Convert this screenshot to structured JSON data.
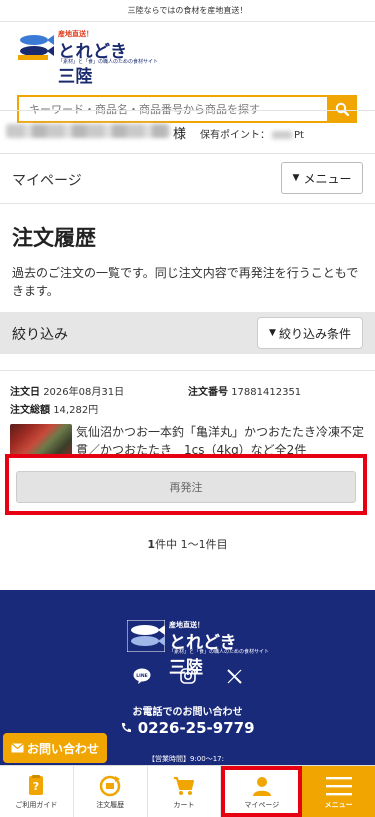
{
  "topbar": {
    "text": "三陸ならではの食材を産地直送！"
  },
  "header": {
    "logo": {
      "tag": "産地直送！",
      "name": "とれどき三陸",
      "sub": "「素材」と「食」の職人のための食材サイト"
    },
    "search": {
      "placeholder": "キーワード・商品名・商品番号から商品を探す"
    }
  },
  "member": {
    "suffix": "様",
    "points_label": "保有ポイント：",
    "points_unit": "Pt"
  },
  "mypage": {
    "title": "マイページ",
    "menu_label": "メニュー"
  },
  "page": {
    "title": "注文履歴",
    "description": "過去のご注文の一覧です。同じ注文内容で再発注を行うこともできます。"
  },
  "filter": {
    "title": "絞り込み",
    "button_label": "絞り込み条件"
  },
  "order": {
    "date_label": "注文日",
    "date": "2026年08月31日",
    "number_label": "注文番号",
    "number": "17881412351",
    "total_label": "注文総額",
    "total": "14,282円",
    "product_description": "気仙沼かつお一本釣「亀洋丸」かつおたたき冷凍不定貫／かつおたたき　1cs（4kg）など全2件",
    "reorder_label": "再発注"
  },
  "pager": {
    "count": "1",
    "text": "件中 1〜1件目"
  },
  "footer": {
    "logo": {
      "tag": "産地直送！",
      "name": "とれどき三陸",
      "sub": "「素材」と「食」の職人のための食材サイト"
    },
    "social": [
      "line-icon",
      "instagram-icon",
      "x-icon"
    ],
    "tel_label": "お電話でのお問い合わせ",
    "tel": "0226-25-9779",
    "hours": "【営業時間】9:00〜17:"
  },
  "contact_button": {
    "label": "お問い合わせ"
  },
  "tabbar": [
    {
      "label": "ご利用ガイド",
      "icon": "guide-icon"
    },
    {
      "label": "注文履歴",
      "icon": "order-history-icon"
    },
    {
      "label": "カート",
      "icon": "cart-icon"
    },
    {
      "label": "マイページ",
      "icon": "user-icon"
    },
    {
      "label": "メニュー",
      "icon": "hamburger-icon"
    }
  ],
  "colors": {
    "accent": "#f0a500",
    "navy": "#1a2a7a",
    "highlight": "#e60012"
  }
}
